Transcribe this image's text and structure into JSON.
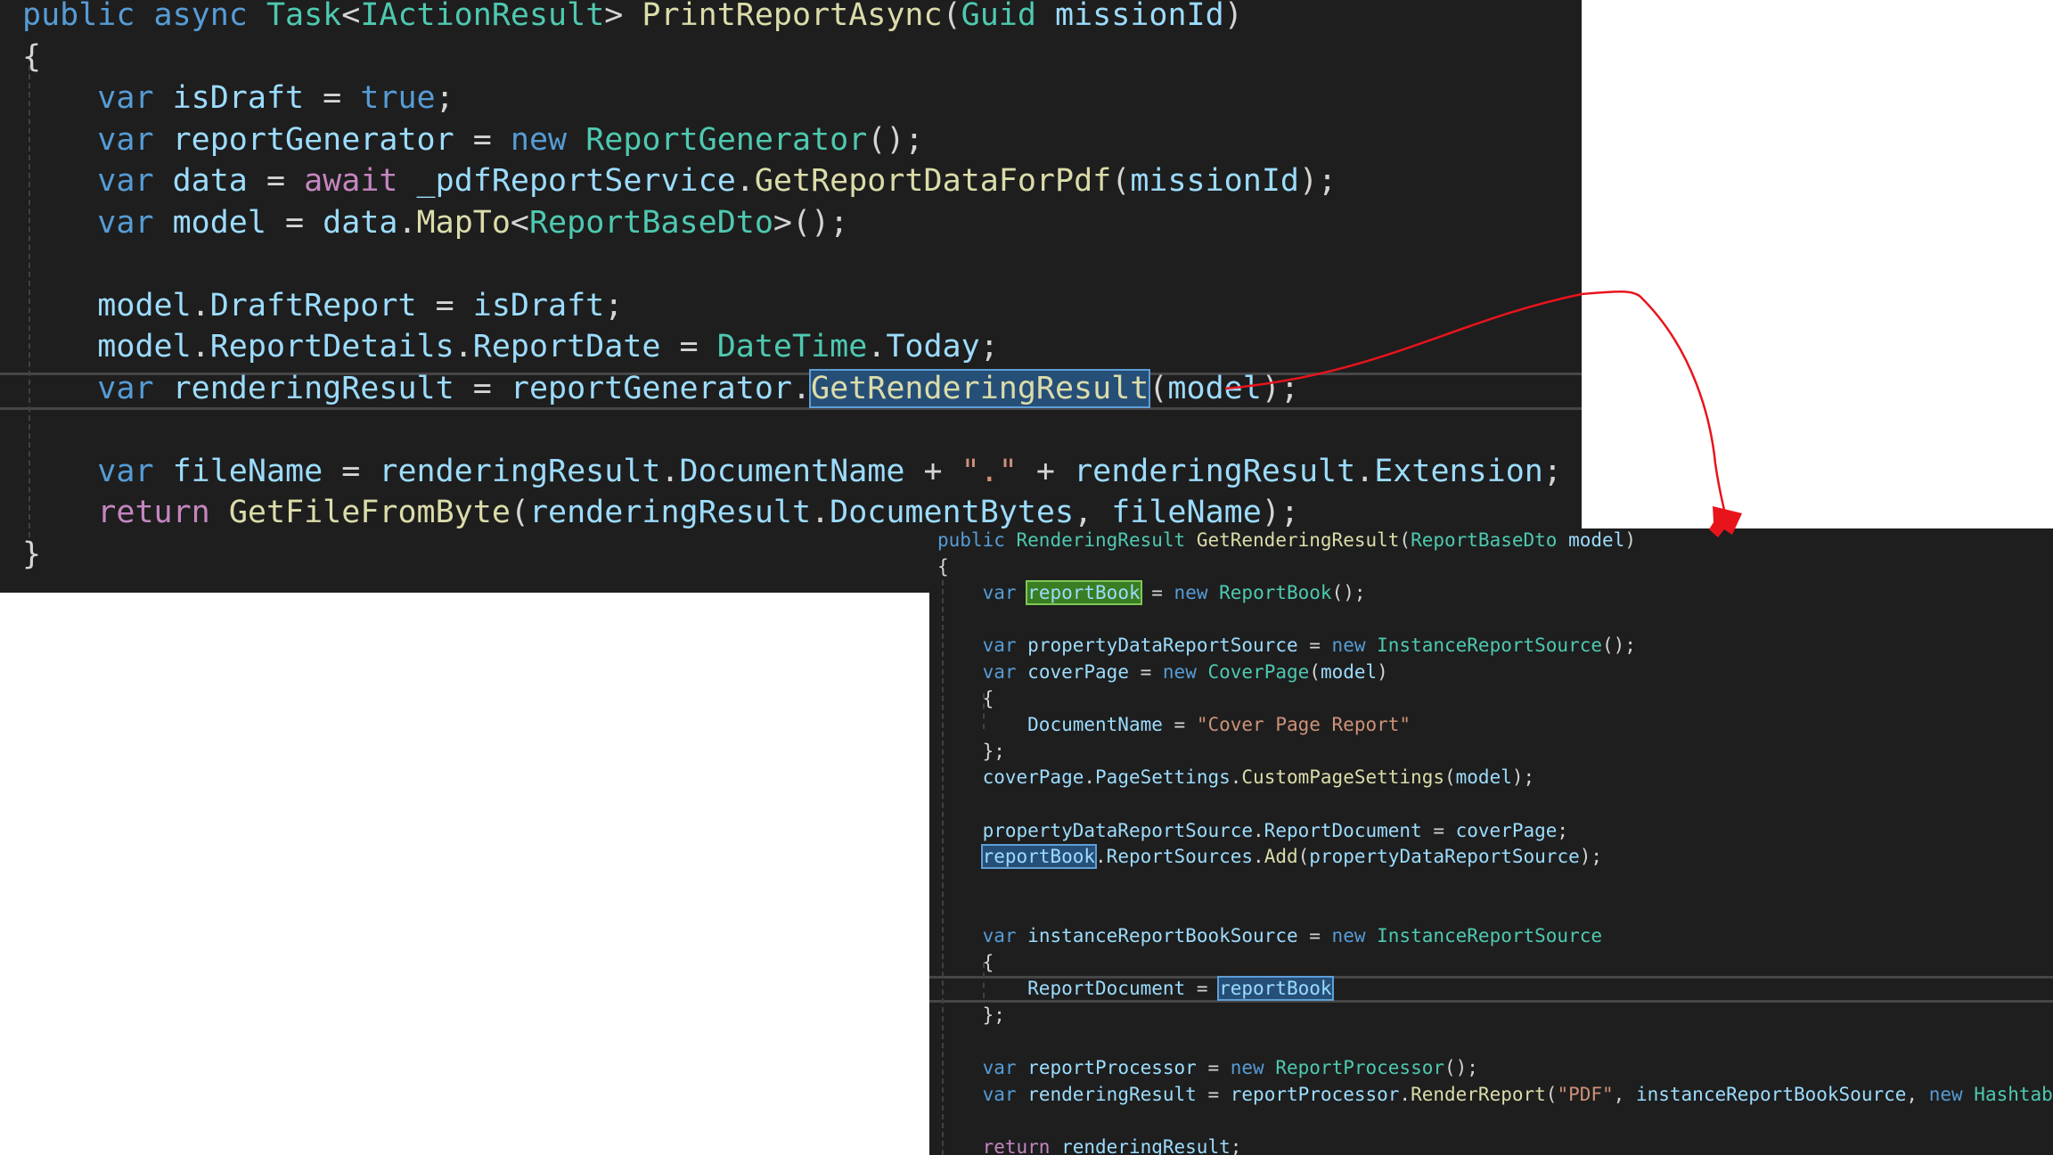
{
  "outer_method": {
    "lines": [
      [
        [
          "kw",
          "public"
        ],
        [
          "pl",
          " "
        ],
        [
          "kw",
          "async"
        ],
        [
          "pl",
          " "
        ],
        [
          "ty",
          "Task"
        ],
        [
          "pl",
          "<"
        ],
        [
          "ty",
          "IActionResult"
        ],
        [
          "pl",
          "> "
        ],
        [
          "fn",
          "PrintReportAsync"
        ],
        [
          "pl",
          "("
        ],
        [
          "ty",
          "Guid"
        ],
        [
          "pl",
          " "
        ],
        [
          "id",
          "missionId"
        ],
        [
          "pl",
          ")"
        ]
      ],
      [
        [
          "pl",
          "{"
        ]
      ],
      [
        [
          "pl",
          "    "
        ],
        [
          "kw",
          "var"
        ],
        [
          "pl",
          " "
        ],
        [
          "id",
          "isDraft"
        ],
        [
          "pl",
          " = "
        ],
        [
          "kw",
          "true"
        ],
        [
          "pl",
          ";"
        ]
      ],
      [
        [
          "pl",
          "    "
        ],
        [
          "kw",
          "var"
        ],
        [
          "pl",
          " "
        ],
        [
          "id",
          "reportGenerator"
        ],
        [
          "pl",
          " = "
        ],
        [
          "kw",
          "new"
        ],
        [
          "pl",
          " "
        ],
        [
          "ty",
          "ReportGenerator"
        ],
        [
          "pl",
          "();"
        ]
      ],
      [
        [
          "pl",
          "    "
        ],
        [
          "kw",
          "var"
        ],
        [
          "pl",
          " "
        ],
        [
          "id",
          "data"
        ],
        [
          "pl",
          " = "
        ],
        [
          "ctl",
          "await"
        ],
        [
          "pl",
          " "
        ],
        [
          "id",
          "_pdfReportService"
        ],
        [
          "pl",
          "."
        ],
        [
          "fn",
          "GetReportDataForPdf"
        ],
        [
          "pl",
          "("
        ],
        [
          "id",
          "missionId"
        ],
        [
          "pl",
          ");"
        ]
      ],
      [
        [
          "pl",
          "    "
        ],
        [
          "kw",
          "var"
        ],
        [
          "pl",
          " "
        ],
        [
          "id",
          "model"
        ],
        [
          "pl",
          " = "
        ],
        [
          "id",
          "data"
        ],
        [
          "pl",
          "."
        ],
        [
          "fn",
          "MapTo"
        ],
        [
          "pl",
          "<"
        ],
        [
          "ty",
          "ReportBaseDto"
        ],
        [
          "pl",
          ">();"
        ]
      ],
      [],
      [
        [
          "pl",
          "    "
        ],
        [
          "id",
          "model"
        ],
        [
          "pl",
          "."
        ],
        [
          "id",
          "DraftReport"
        ],
        [
          "pl",
          " = "
        ],
        [
          "id",
          "isDraft"
        ],
        [
          "pl",
          ";"
        ]
      ],
      [
        [
          "pl",
          "    "
        ],
        [
          "id",
          "model"
        ],
        [
          "pl",
          "."
        ],
        [
          "id",
          "ReportDetails"
        ],
        [
          "pl",
          "."
        ],
        [
          "id",
          "ReportDate"
        ],
        [
          "pl",
          " = "
        ],
        [
          "ty",
          "DateTime"
        ],
        [
          "pl",
          "."
        ],
        [
          "id",
          "Today"
        ],
        [
          "pl",
          ";"
        ]
      ],
      [
        [
          "pl",
          "    "
        ],
        [
          "kw",
          "var"
        ],
        [
          "pl",
          " "
        ],
        [
          "id",
          "renderingResult"
        ],
        [
          "pl",
          " = "
        ],
        [
          "id",
          "reportGenerator"
        ],
        [
          "pl",
          "."
        ],
        [
          "fn",
          "GetRenderingResult",
          "hl-blue"
        ],
        [
          "pl",
          "("
        ],
        [
          "id",
          "model"
        ],
        [
          "pl",
          ");"
        ]
      ],
      [],
      [
        [
          "pl",
          "    "
        ],
        [
          "kw",
          "var"
        ],
        [
          "pl",
          " "
        ],
        [
          "id",
          "fileName"
        ],
        [
          "pl",
          " = "
        ],
        [
          "id",
          "renderingResult"
        ],
        [
          "pl",
          "."
        ],
        [
          "id",
          "DocumentName"
        ],
        [
          "pl",
          " + "
        ],
        [
          "str",
          "\".\""
        ],
        [
          "pl",
          " + "
        ],
        [
          "id",
          "renderingResult"
        ],
        [
          "pl",
          "."
        ],
        [
          "id",
          "Extension"
        ],
        [
          "pl",
          ";"
        ]
      ],
      [
        [
          "pl",
          "    "
        ],
        [
          "ctl",
          "return"
        ],
        [
          "pl",
          " "
        ],
        [
          "fn",
          "GetFileFromByte"
        ],
        [
          "pl",
          "("
        ],
        [
          "id",
          "renderingResult"
        ],
        [
          "pl",
          "."
        ],
        [
          "id",
          "DocumentBytes"
        ],
        [
          "pl",
          ", "
        ],
        [
          "id",
          "fileName"
        ],
        [
          "pl",
          ");"
        ]
      ],
      [
        [
          "pl",
          "}"
        ]
      ]
    ]
  },
  "inner_method": {
    "lines": [
      [
        [
          "kw",
          "public"
        ],
        [
          "pl",
          " "
        ],
        [
          "ty",
          "RenderingResult"
        ],
        [
          "pl",
          " "
        ],
        [
          "fn",
          "GetRenderingResult"
        ],
        [
          "pl",
          "("
        ],
        [
          "ty",
          "ReportBaseDto"
        ],
        [
          "pl",
          " "
        ],
        [
          "id",
          "model"
        ],
        [
          "pl",
          ")"
        ]
      ],
      [
        [
          "pl",
          "{"
        ]
      ],
      [
        [
          "pl",
          "    "
        ],
        [
          "kw",
          "var"
        ],
        [
          "pl",
          " "
        ],
        [
          "id",
          "reportBook",
          "hl-green"
        ],
        [
          "pl",
          " = "
        ],
        [
          "kw",
          "new"
        ],
        [
          "pl",
          " "
        ],
        [
          "ty",
          "ReportBook"
        ],
        [
          "pl",
          "();"
        ]
      ],
      [],
      [
        [
          "pl",
          "    "
        ],
        [
          "kw",
          "var"
        ],
        [
          "pl",
          " "
        ],
        [
          "id",
          "propertyDataReportSource"
        ],
        [
          "pl",
          " = "
        ],
        [
          "kw",
          "new"
        ],
        [
          "pl",
          " "
        ],
        [
          "ty",
          "InstanceReportSource"
        ],
        [
          "pl",
          "();"
        ]
      ],
      [
        [
          "pl",
          "    "
        ],
        [
          "kw",
          "var"
        ],
        [
          "pl",
          " "
        ],
        [
          "id",
          "coverPage"
        ],
        [
          "pl",
          " = "
        ],
        [
          "kw",
          "new"
        ],
        [
          "pl",
          " "
        ],
        [
          "ty",
          "CoverPage"
        ],
        [
          "pl",
          "("
        ],
        [
          "id",
          "model"
        ],
        [
          "pl",
          ")"
        ]
      ],
      [
        [
          "pl",
          "    {"
        ]
      ],
      [
        [
          "pl",
          "        "
        ],
        [
          "id",
          "DocumentName"
        ],
        [
          "pl",
          " = "
        ],
        [
          "str",
          "\"Cover Page Report\""
        ]
      ],
      [
        [
          "pl",
          "    };"
        ]
      ],
      [
        [
          "pl",
          "    "
        ],
        [
          "id",
          "coverPage"
        ],
        [
          "pl",
          "."
        ],
        [
          "id",
          "PageSettings"
        ],
        [
          "pl",
          "."
        ],
        [
          "fn",
          "CustomPageSettings"
        ],
        [
          "pl",
          "("
        ],
        [
          "id",
          "model"
        ],
        [
          "pl",
          ");"
        ]
      ],
      [],
      [
        [
          "pl",
          "    "
        ],
        [
          "id",
          "propertyDataReportSource"
        ],
        [
          "pl",
          "."
        ],
        [
          "id",
          "ReportDocument"
        ],
        [
          "pl",
          " = "
        ],
        [
          "id",
          "coverPage"
        ],
        [
          "pl",
          ";"
        ]
      ],
      [
        [
          "pl",
          "    "
        ],
        [
          "id",
          "reportBook",
          "hl-blue"
        ],
        [
          "pl",
          "."
        ],
        [
          "id",
          "ReportSources"
        ],
        [
          "pl",
          "."
        ],
        [
          "fn",
          "Add"
        ],
        [
          "pl",
          "("
        ],
        [
          "id",
          "propertyDataReportSource"
        ],
        [
          "pl",
          ");"
        ]
      ],
      [],
      [],
      [
        [
          "pl",
          "    "
        ],
        [
          "kw",
          "var"
        ],
        [
          "pl",
          " "
        ],
        [
          "id",
          "instanceReportBookSource"
        ],
        [
          "pl",
          " = "
        ],
        [
          "kw",
          "new"
        ],
        [
          "pl",
          " "
        ],
        [
          "ty",
          "InstanceReportSource"
        ]
      ],
      [
        [
          "pl",
          "    {"
        ]
      ],
      [
        [
          "pl",
          "        "
        ],
        [
          "id",
          "ReportDocument"
        ],
        [
          "pl",
          " = "
        ],
        [
          "id",
          "reportBook",
          "hl-blue"
        ]
      ],
      [
        [
          "pl",
          "    };"
        ]
      ],
      [],
      [
        [
          "pl",
          "    "
        ],
        [
          "kw",
          "var"
        ],
        [
          "pl",
          " "
        ],
        [
          "id",
          "reportProcessor"
        ],
        [
          "pl",
          " = "
        ],
        [
          "kw",
          "new"
        ],
        [
          "pl",
          " "
        ],
        [
          "ty",
          "ReportProcessor"
        ],
        [
          "pl",
          "();"
        ]
      ],
      [
        [
          "pl",
          "    "
        ],
        [
          "kw",
          "var"
        ],
        [
          "pl",
          " "
        ],
        [
          "id",
          "renderingResult"
        ],
        [
          "pl",
          " = "
        ],
        [
          "id",
          "reportProcessor"
        ],
        [
          "pl",
          "."
        ],
        [
          "fn",
          "RenderReport"
        ],
        [
          "pl",
          "("
        ],
        [
          "str",
          "\"PDF\""
        ],
        [
          "pl",
          ", "
        ],
        [
          "id",
          "instanceReportBookSource"
        ],
        [
          "pl",
          ", "
        ],
        [
          "kw",
          "new"
        ],
        [
          "pl",
          " "
        ],
        [
          "ty",
          "Hashtable"
        ],
        [
          "pl",
          "());"
        ]
      ],
      [],
      [
        [
          "pl",
          "    "
        ],
        [
          "ctl",
          "return"
        ],
        [
          "pl",
          " "
        ],
        [
          "id",
          "renderingResult"
        ],
        [
          "pl",
          ";"
        ]
      ]
    ]
  },
  "colors": {
    "editor_background": "#1e1e1e",
    "annotation_arrow": "#e8141c"
  }
}
